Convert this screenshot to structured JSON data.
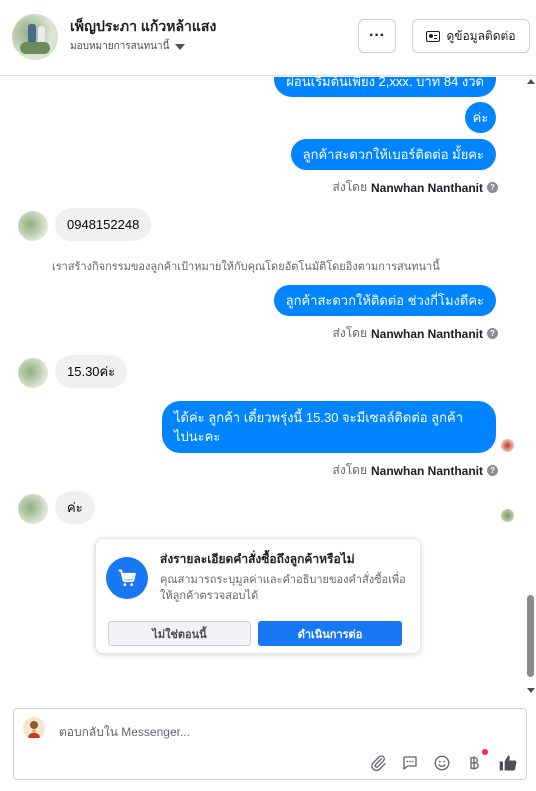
{
  "header": {
    "name": "เพ็ญประภา แก้วหล้าแสง",
    "assign_label": "มอบหมายการสนทนานี้",
    "more_label": "···",
    "contact_label": "ดูข้อมูลติดต่อ"
  },
  "messages": {
    "m1": "ผ่อนเริ่มต้นเพียง 2,xxx. บาท 84 งวด",
    "m2": "ค่ะ",
    "m3": "ลูกค้าสะดวกให้เบอร์ติดต่อ มั้ยคะ",
    "sentby_prefix": "ส่งโดย",
    "agent": "Nanwhan Nanthanit",
    "in1": "0948152248",
    "system": "เราสร้างกิจกรรมของลูกค้าเป้าหมายให้กับคุณโดยอัตโนมัติโดยอิงตามการสนทนานี้",
    "m4": "ลูกค้าสะดวกให้ติดต่อ ช่วงกี่โมงดีคะ",
    "in2": "15.30ค่ะ",
    "m5_line1": "ได้ค่ะ ลูกค้า เดี๋ยวพรุ่งนี้ 15.30 จะมีเซลล์ติดต่อ ลูกค้า",
    "m5_line2": "ไปนะคะ",
    "in3": "ค่ะ",
    "help": "?"
  },
  "card": {
    "title": "ส่งรายละเอียดคำสั่งซื้อถึงลูกค้าหรือไม่",
    "desc": "คุณสามารถระบุมูลค่าและคำอธิบายของคำสั่งซื้อเพื่อให้ลูกค้าตรวจสอบได้",
    "no_label": "ไม่ใช่ตอนนี้",
    "go_label": "ดำเนินการต่อ"
  },
  "composer": {
    "placeholder": "ตอบกลับใน Messenger...",
    "tools": [
      "paperclip-icon",
      "saved-reply-icon",
      "emoji-icon",
      "baht-icon",
      "thumbs-up-icon"
    ]
  },
  "colors": {
    "accent": "#0084ff",
    "brand": "#1877f2",
    "incoming_bg": "#f1f0f0"
  }
}
